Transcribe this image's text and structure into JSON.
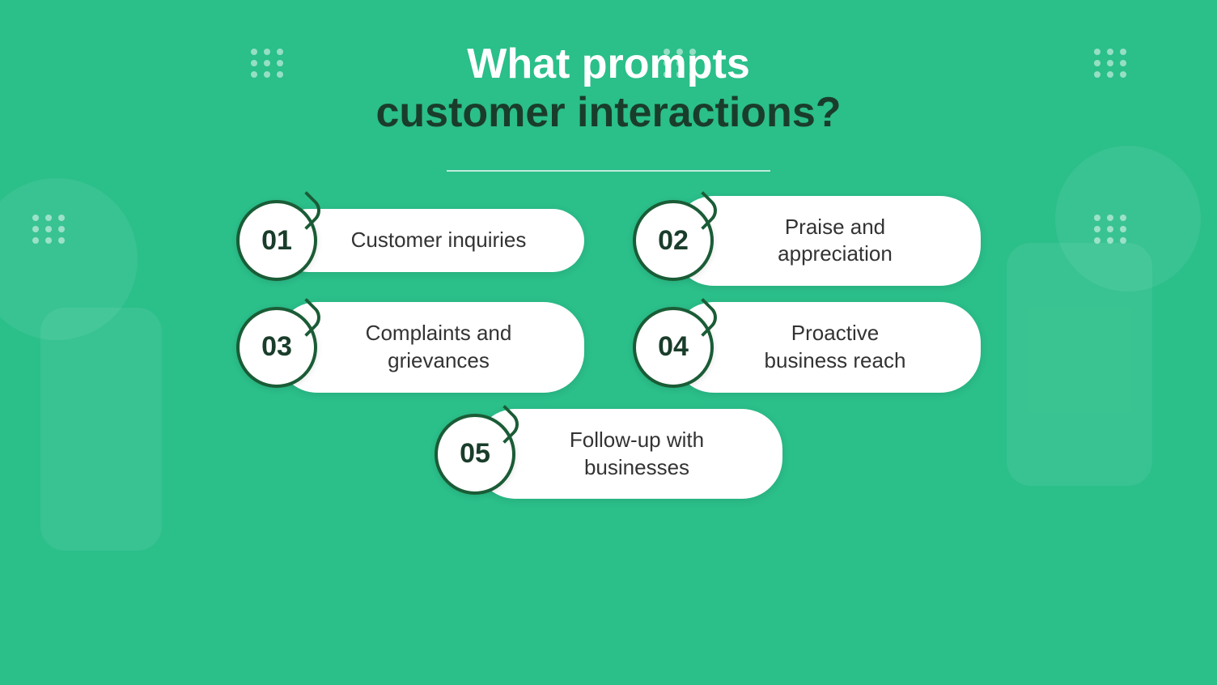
{
  "title": {
    "line1": "What prompts",
    "line2": "customer interactions?"
  },
  "cards": [
    {
      "number": "01",
      "label": "Customer inquiries"
    },
    {
      "number": "02",
      "label": "Praise and\nappreciation"
    },
    {
      "number": "03",
      "label": "Complaints and\ngrievances"
    },
    {
      "number": "04",
      "label": "Proactive\nbusiness reach"
    },
    {
      "number": "05",
      "label": "Follow-up with\nbusinesses"
    }
  ],
  "colors": {
    "background": "#2bbf8a",
    "circle_border": "#1a5c36",
    "title_dark": "#1a3d2b",
    "title_light": "#ffffff",
    "pill_bg": "#ffffff",
    "text_color": "#333333"
  }
}
